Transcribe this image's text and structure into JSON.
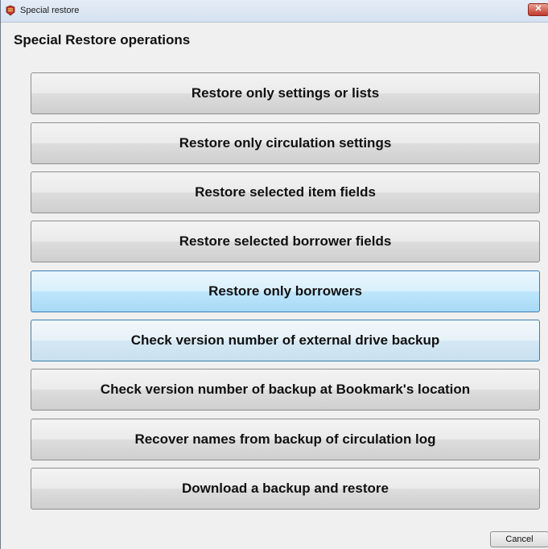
{
  "window": {
    "title": "Special restore",
    "close_glyph": "✕",
    "icon": "app-icon"
  },
  "heading": "Special Restore operations",
  "buttons": [
    {
      "label": "Restore only settings or lists",
      "state": "normal"
    },
    {
      "label": "Restore only circulation settings",
      "state": "normal"
    },
    {
      "label": "Restore selected item fields",
      "state": "normal"
    },
    {
      "label": "Restore selected borrower fields",
      "state": "normal"
    },
    {
      "label": "Restore only borrowers",
      "state": "hover"
    },
    {
      "label": "Check version number of external drive backup",
      "state": "focus"
    },
    {
      "label": "Check version number of backup at Bookmark's location",
      "state": "normal"
    },
    {
      "label": "Recover names from backup of circulation log",
      "state": "normal"
    },
    {
      "label": "Download a backup and restore",
      "state": "normal"
    }
  ],
  "cancel_label": "Cancel",
  "colors": {
    "hover_border": "#3c7fb1",
    "hover_fill": "#bee6fd",
    "close_red": "#c0392b"
  }
}
